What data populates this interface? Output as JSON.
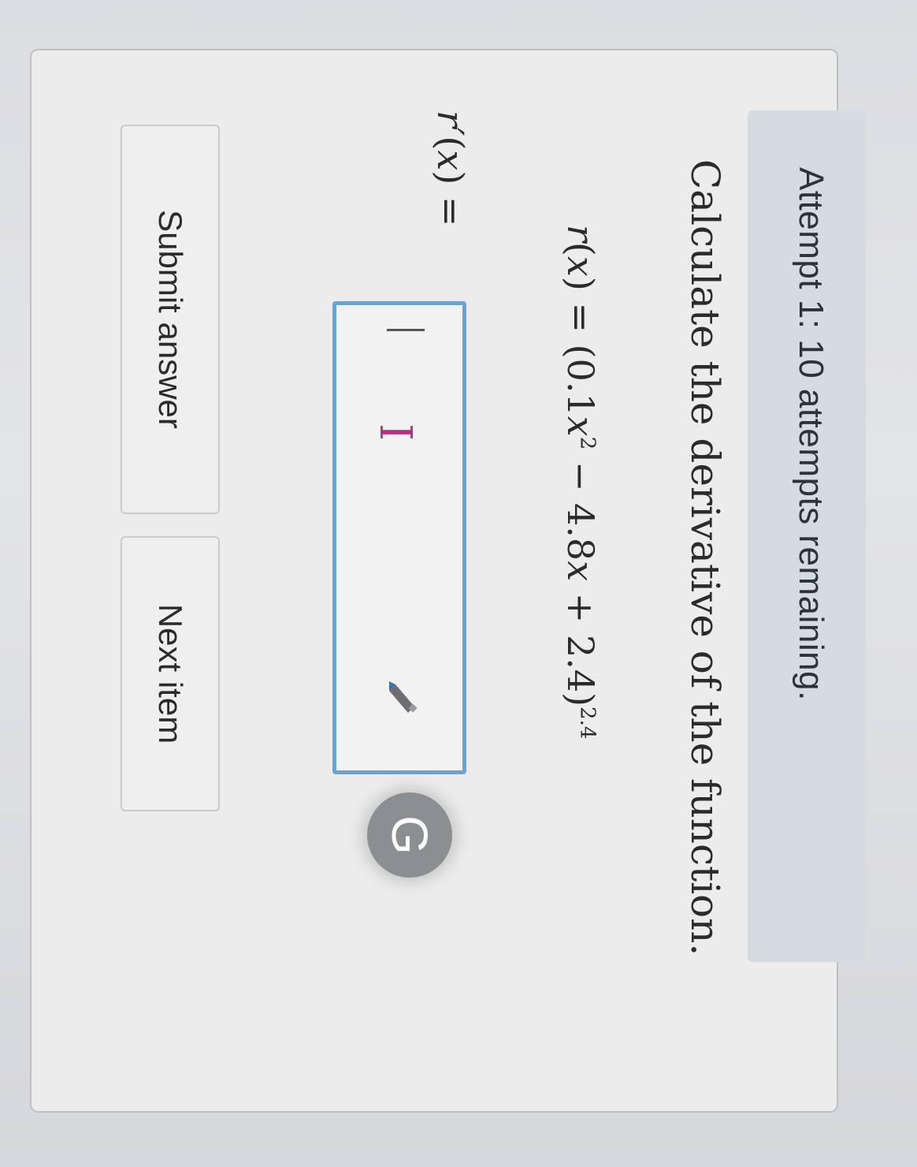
{
  "status": {
    "attempt_text": "Attempt 1: 10 attempts remaining."
  },
  "question": {
    "prompt": "Calculate the derivative of the function.",
    "function": {
      "name": "r",
      "var": "x",
      "lhs_open": "(",
      "lhs_close": ") = ",
      "expr_open": "(0.1",
      "exp1": "2",
      "mid": " − 4.8",
      "end": " + 2.4)",
      "outer_exp": "2.4"
    },
    "answer": {
      "label_fn": "r′",
      "var": "x",
      "label_close": ") = ",
      "value": ""
    }
  },
  "icons": {
    "g_icon_text": "G"
  },
  "buttons": {
    "submit_label": "Submit answer",
    "next_label": "Next item"
  }
}
